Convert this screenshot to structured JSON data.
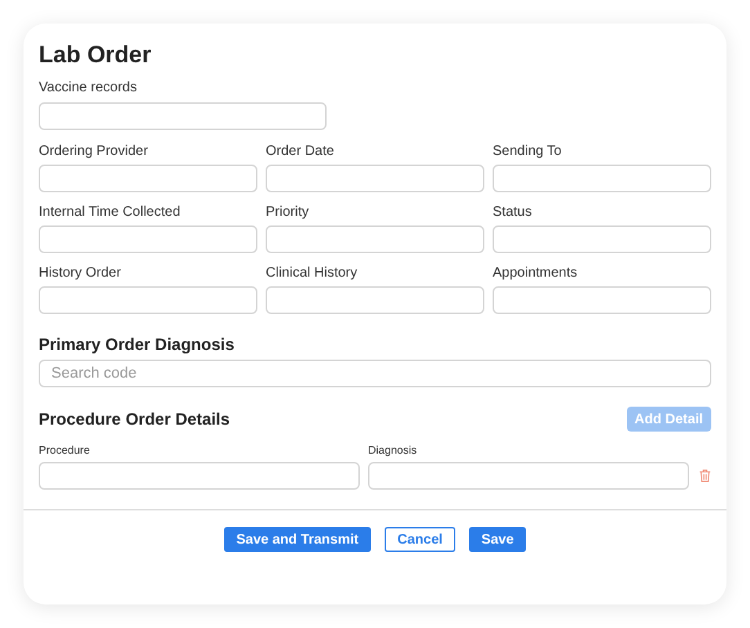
{
  "title": "Lab Order",
  "top_field": {
    "label": "Vaccine records"
  },
  "fields": [
    {
      "label": "Ordering Provider"
    },
    {
      "label": "Order Date"
    },
    {
      "label": "Sending To"
    },
    {
      "label": "Internal Time Collected"
    },
    {
      "label": "Priority"
    },
    {
      "label": "Status"
    },
    {
      "label": "History Order"
    },
    {
      "label": "Clinical History"
    },
    {
      "label": "Appointments"
    }
  ],
  "diagnosis": {
    "heading": "Primary Order Diagnosis",
    "placeholder": "Search code"
  },
  "procedure": {
    "heading": "Procedure Order Details",
    "add_button": {
      "label": "Add Detail",
      "disabled": true
    },
    "columns": [
      {
        "label": "Procedure"
      },
      {
        "label": "Diagnosis"
      }
    ]
  },
  "buttons": [
    {
      "label": "Save and Transmit",
      "kind": "primary"
    },
    {
      "label": "Cancel",
      "kind": "outline"
    },
    {
      "label": "Save",
      "kind": "primary"
    }
  ]
}
